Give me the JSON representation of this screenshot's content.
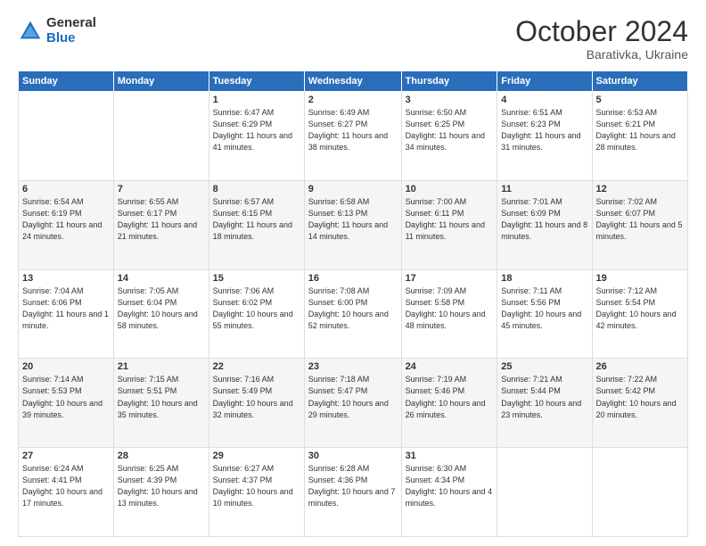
{
  "logo": {
    "general": "General",
    "blue": "Blue"
  },
  "header": {
    "month": "October 2024",
    "location": "Barativka, Ukraine"
  },
  "weekdays": [
    "Sunday",
    "Monday",
    "Tuesday",
    "Wednesday",
    "Thursday",
    "Friday",
    "Saturday"
  ],
  "weeks": [
    [
      {
        "day": "",
        "info": ""
      },
      {
        "day": "",
        "info": ""
      },
      {
        "day": "1",
        "info": "Sunrise: 6:47 AM\nSunset: 6:29 PM\nDaylight: 11 hours and 41 minutes."
      },
      {
        "day": "2",
        "info": "Sunrise: 6:49 AM\nSunset: 6:27 PM\nDaylight: 11 hours and 38 minutes."
      },
      {
        "day": "3",
        "info": "Sunrise: 6:50 AM\nSunset: 6:25 PM\nDaylight: 11 hours and 34 minutes."
      },
      {
        "day": "4",
        "info": "Sunrise: 6:51 AM\nSunset: 6:23 PM\nDaylight: 11 hours and 31 minutes."
      },
      {
        "day": "5",
        "info": "Sunrise: 6:53 AM\nSunset: 6:21 PM\nDaylight: 11 hours and 28 minutes."
      }
    ],
    [
      {
        "day": "6",
        "info": "Sunrise: 6:54 AM\nSunset: 6:19 PM\nDaylight: 11 hours and 24 minutes."
      },
      {
        "day": "7",
        "info": "Sunrise: 6:55 AM\nSunset: 6:17 PM\nDaylight: 11 hours and 21 minutes."
      },
      {
        "day": "8",
        "info": "Sunrise: 6:57 AM\nSunset: 6:15 PM\nDaylight: 11 hours and 18 minutes."
      },
      {
        "day": "9",
        "info": "Sunrise: 6:58 AM\nSunset: 6:13 PM\nDaylight: 11 hours and 14 minutes."
      },
      {
        "day": "10",
        "info": "Sunrise: 7:00 AM\nSunset: 6:11 PM\nDaylight: 11 hours and 11 minutes."
      },
      {
        "day": "11",
        "info": "Sunrise: 7:01 AM\nSunset: 6:09 PM\nDaylight: 11 hours and 8 minutes."
      },
      {
        "day": "12",
        "info": "Sunrise: 7:02 AM\nSunset: 6:07 PM\nDaylight: 11 hours and 5 minutes."
      }
    ],
    [
      {
        "day": "13",
        "info": "Sunrise: 7:04 AM\nSunset: 6:06 PM\nDaylight: 11 hours and 1 minute."
      },
      {
        "day": "14",
        "info": "Sunrise: 7:05 AM\nSunset: 6:04 PM\nDaylight: 10 hours and 58 minutes."
      },
      {
        "day": "15",
        "info": "Sunrise: 7:06 AM\nSunset: 6:02 PM\nDaylight: 10 hours and 55 minutes."
      },
      {
        "day": "16",
        "info": "Sunrise: 7:08 AM\nSunset: 6:00 PM\nDaylight: 10 hours and 52 minutes."
      },
      {
        "day": "17",
        "info": "Sunrise: 7:09 AM\nSunset: 5:58 PM\nDaylight: 10 hours and 48 minutes."
      },
      {
        "day": "18",
        "info": "Sunrise: 7:11 AM\nSunset: 5:56 PM\nDaylight: 10 hours and 45 minutes."
      },
      {
        "day": "19",
        "info": "Sunrise: 7:12 AM\nSunset: 5:54 PM\nDaylight: 10 hours and 42 minutes."
      }
    ],
    [
      {
        "day": "20",
        "info": "Sunrise: 7:14 AM\nSunset: 5:53 PM\nDaylight: 10 hours and 39 minutes."
      },
      {
        "day": "21",
        "info": "Sunrise: 7:15 AM\nSunset: 5:51 PM\nDaylight: 10 hours and 35 minutes."
      },
      {
        "day": "22",
        "info": "Sunrise: 7:16 AM\nSunset: 5:49 PM\nDaylight: 10 hours and 32 minutes."
      },
      {
        "day": "23",
        "info": "Sunrise: 7:18 AM\nSunset: 5:47 PM\nDaylight: 10 hours and 29 minutes."
      },
      {
        "day": "24",
        "info": "Sunrise: 7:19 AM\nSunset: 5:46 PM\nDaylight: 10 hours and 26 minutes."
      },
      {
        "day": "25",
        "info": "Sunrise: 7:21 AM\nSunset: 5:44 PM\nDaylight: 10 hours and 23 minutes."
      },
      {
        "day": "26",
        "info": "Sunrise: 7:22 AM\nSunset: 5:42 PM\nDaylight: 10 hours and 20 minutes."
      }
    ],
    [
      {
        "day": "27",
        "info": "Sunrise: 6:24 AM\nSunset: 4:41 PM\nDaylight: 10 hours and 17 minutes."
      },
      {
        "day": "28",
        "info": "Sunrise: 6:25 AM\nSunset: 4:39 PM\nDaylight: 10 hours and 13 minutes."
      },
      {
        "day": "29",
        "info": "Sunrise: 6:27 AM\nSunset: 4:37 PM\nDaylight: 10 hours and 10 minutes."
      },
      {
        "day": "30",
        "info": "Sunrise: 6:28 AM\nSunset: 4:36 PM\nDaylight: 10 hours and 7 minutes."
      },
      {
        "day": "31",
        "info": "Sunrise: 6:30 AM\nSunset: 4:34 PM\nDaylight: 10 hours and 4 minutes."
      },
      {
        "day": "",
        "info": ""
      },
      {
        "day": "",
        "info": ""
      }
    ]
  ]
}
